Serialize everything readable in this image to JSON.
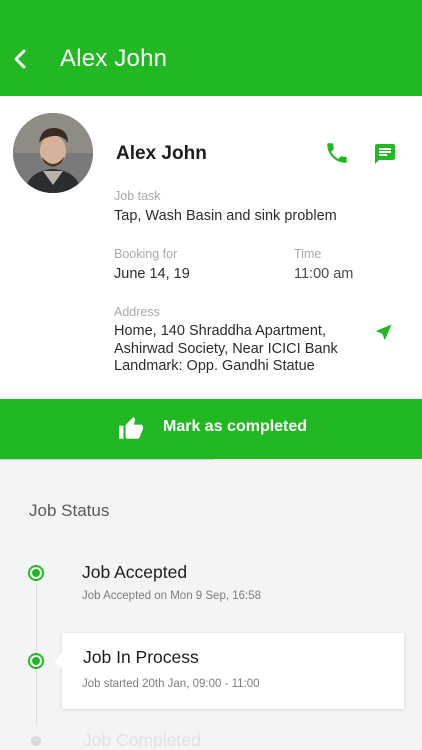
{
  "header": {
    "title": "Alex John",
    "back_icon": "chevron-left-icon"
  },
  "customer": {
    "name": "Alex John",
    "avatar": "avatar-photo",
    "actions": {
      "call_icon": "phone-icon",
      "message_icon": "message-icon"
    }
  },
  "job": {
    "task_label": "Job task",
    "task_value": "Tap, Wash Basin and sink problem",
    "booking_label": "Booking for",
    "booking_value": "June 14, 19",
    "time_label": "Time",
    "time_value": "11:00 am",
    "address_label": "Address",
    "address_lines": [
      "Home, 140 Shraddha Apartment,",
      "Ashirwad Society, Near ICICI Bank",
      "Landmark: Opp. Gandhi Statue"
    ],
    "navigate_icon": "navigation-arrow-icon"
  },
  "complete_button": {
    "label": "Mark as completed",
    "icon": "thumbs-up-icon"
  },
  "status": {
    "title": "Job Status",
    "steps": [
      {
        "title": "Job Accepted",
        "detail": "Job Accepted on  Mon 9 Sep, 16:58",
        "state": "done"
      },
      {
        "title": "Job In Process",
        "detail": "Job started  20th Jan, 09:00 - 11:00",
        "state": "active"
      },
      {
        "title": "Job Completed",
        "state": "pending"
      }
    ]
  },
  "colors": {
    "brand_green": "#22b824",
    "background": "#f3f4f6"
  }
}
